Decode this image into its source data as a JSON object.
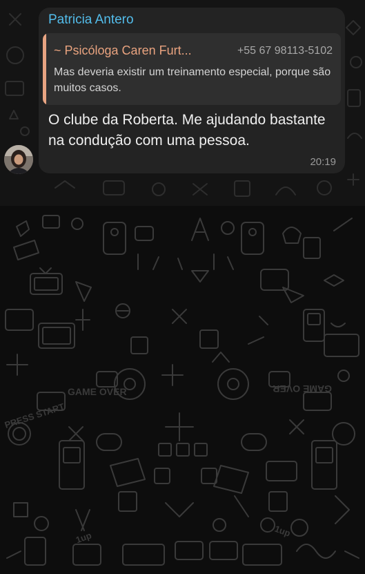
{
  "message": {
    "sender": "Patricia Antero",
    "quoted": {
      "author": "~ Psicóloga Caren Furt...",
      "phone": "+55 67 98113-5102",
      "text": "Mas deveria existir um treinamento especial, porque são muitos casos."
    },
    "text": "O clube da Roberta. Me ajudando bastante na condução com uma pessoa.",
    "time": "20:19"
  },
  "wallpaper": {
    "labels": {
      "game_over": "GAME OVER",
      "press_start": "PRESS START",
      "one_up": "1up"
    }
  },
  "colors": {
    "sender_name": "#53bdeb",
    "quote_accent": "#e8a482",
    "bubble_background": "#232323",
    "wallpaper_background": "#0d0d0d"
  }
}
